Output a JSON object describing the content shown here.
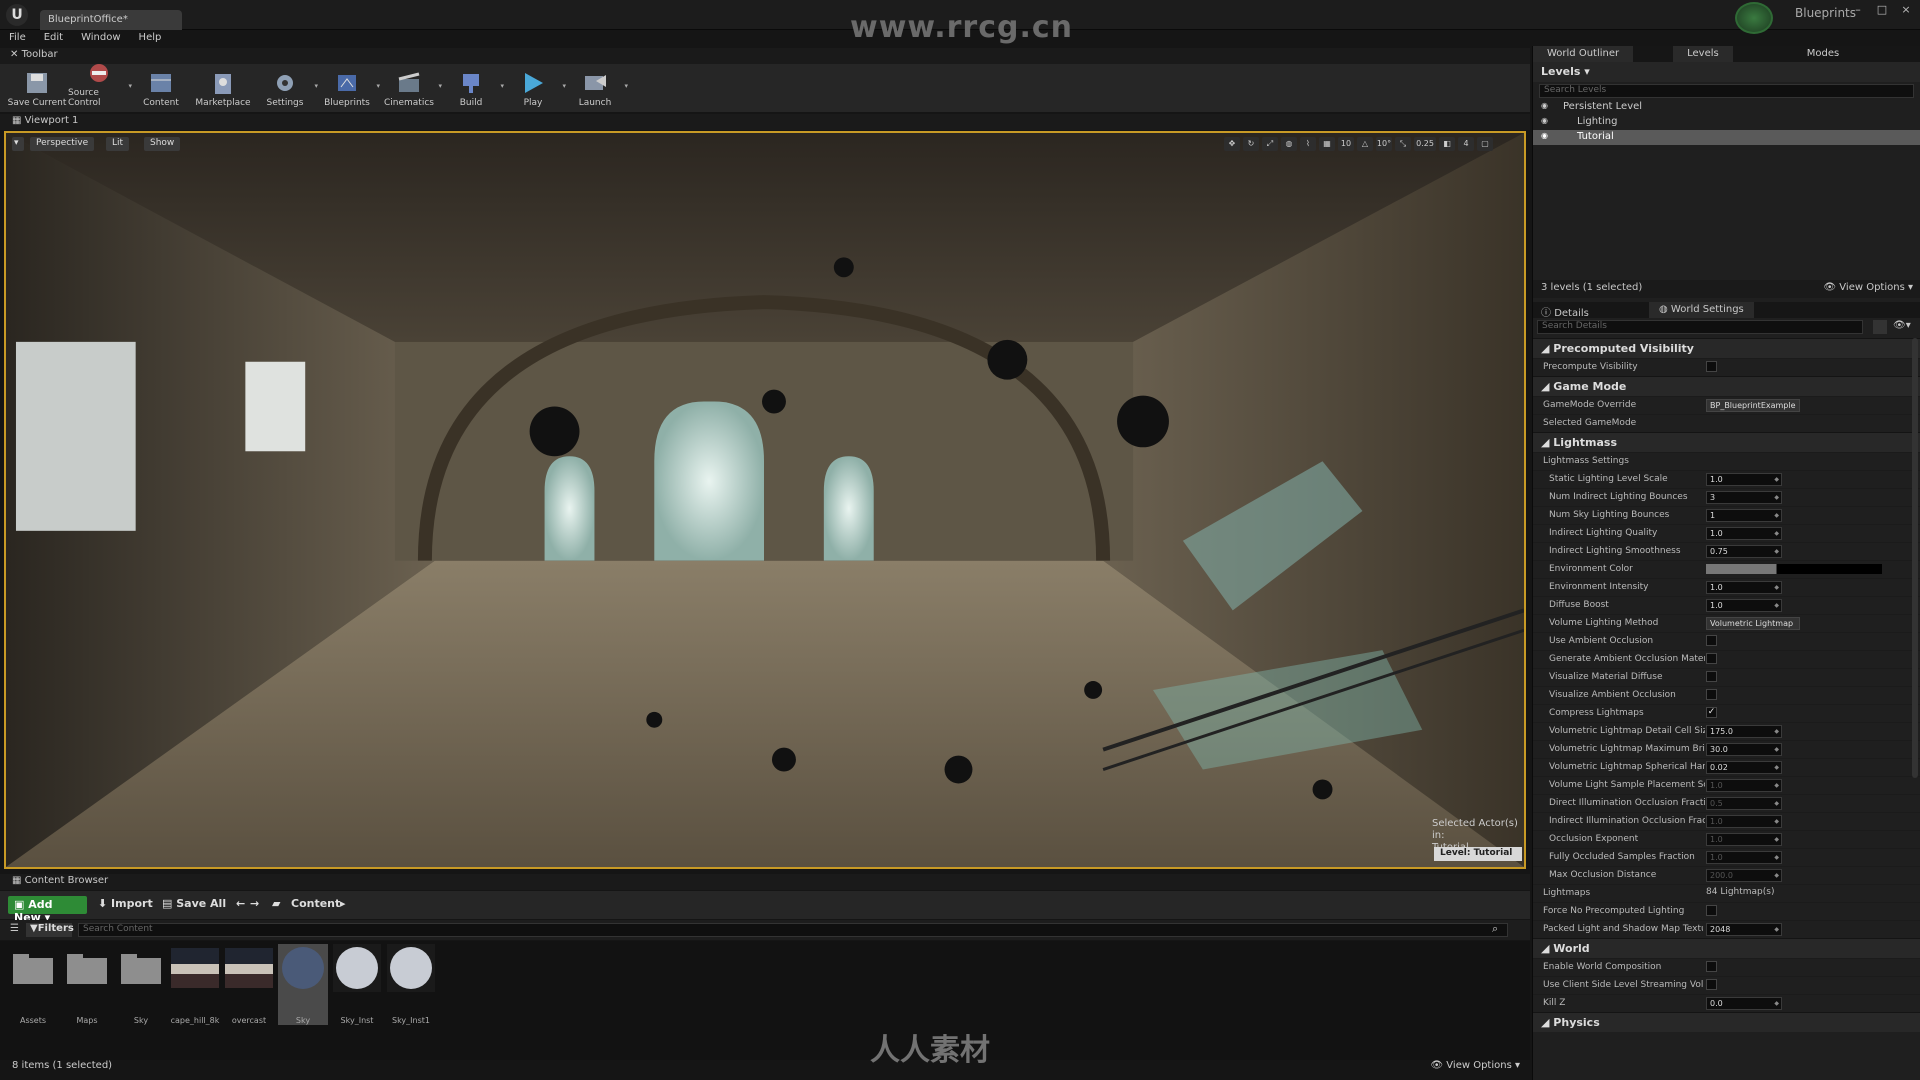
{
  "title_bar": {
    "doc_tab": "BlueprintOffice*",
    "watermark": "www.rrcg.cn",
    "blueprints_label": "Blueprints",
    "window_buttons": [
      "–",
      "□",
      "×"
    ]
  },
  "menu": [
    "File",
    "Edit",
    "Window",
    "Help"
  ],
  "toolbar": {
    "tab": "Toolbar",
    "buttons": [
      {
        "label": "Save Current",
        "icon": "save-icon",
        "dd": false
      },
      {
        "label": "Source Control",
        "icon": "source-control-icon",
        "dd": true
      },
      {
        "label": "Content",
        "icon": "content-icon",
        "dd": false
      },
      {
        "label": "Marketplace",
        "icon": "marketplace-icon",
        "dd": false
      },
      {
        "label": "Settings",
        "icon": "settings-icon",
        "dd": true
      },
      {
        "label": "Blueprints",
        "icon": "blueprints-icon",
        "dd": true
      },
      {
        "label": "Cinematics",
        "icon": "cinematics-icon",
        "dd": true
      },
      {
        "label": "Build",
        "icon": "build-icon",
        "dd": true
      },
      {
        "label": "Play",
        "icon": "play-icon",
        "dd": true
      },
      {
        "label": "Launch",
        "icon": "launch-icon",
        "dd": true
      }
    ]
  },
  "viewport": {
    "tab": "Viewport 1",
    "perspective": "Perspective",
    "lit": "Lit",
    "show": "Show",
    "snap_values": [
      "10",
      "10°",
      "0.25",
      "4"
    ],
    "selected_actor_line1": "Selected Actor(s) in:",
    "selected_actor_line2": "Tutorial",
    "level_label": "Level:  Tutorial",
    "border_color": "#c89a25"
  },
  "content_browser": {
    "tab": "Content Browser",
    "add_new": "Add New",
    "import": "Import",
    "save_all": "Save All",
    "path": "Content",
    "filters": "Filters",
    "search_placeholder": "Search Content",
    "assets": [
      {
        "name": "Assets",
        "type": "folder"
      },
      {
        "name": "Maps",
        "type": "folder"
      },
      {
        "name": "Sky",
        "type": "folder"
      },
      {
        "name": "cape_hill_8k",
        "type": "texture"
      },
      {
        "name": "overcast",
        "type": "texture"
      },
      {
        "name": "Sky",
        "type": "material",
        "selected": true
      },
      {
        "name": "Sky_Inst",
        "type": "material"
      },
      {
        "name": "Sky_Inst1",
        "type": "material"
      }
    ],
    "status": "8 items (1 selected)",
    "view_options": "View Options"
  },
  "world_outliner": {
    "tabs": [
      "World Outliner",
      "Levels",
      "Modes"
    ],
    "levels_header": "Levels",
    "search_placeholder": "Search Levels",
    "rows": [
      {
        "name": "Persistent Level",
        "selected": false
      },
      {
        "name": "Lighting",
        "selected": false
      },
      {
        "name": "Tutorial",
        "selected": true
      }
    ],
    "footer": "3 levels (1 selected)",
    "view_options": "View Options"
  },
  "details": {
    "tabs": [
      "Details",
      "World Settings"
    ],
    "search_placeholder": "Search Details",
    "sections": [
      {
        "title": "Precomputed Visibility",
        "rows": [
          {
            "label": "Precompute Visibility",
            "kind": "check",
            "value": ""
          }
        ]
      },
      {
        "title": "Game Mode",
        "rows": [
          {
            "label": "GameMode Override",
            "kind": "dropdown",
            "value": "BP_BlueprintExample"
          },
          {
            "label": "Selected GameMode",
            "kind": "none",
            "value": ""
          }
        ]
      },
      {
        "title": "Lightmass",
        "rows": [
          {
            "label": "Lightmass Settings",
            "kind": "none",
            "value": ""
          },
          {
            "label": "Static Lighting Level Scale",
            "kind": "num",
            "value": "1.0"
          },
          {
            "label": "Num Indirect Lighting Bounces",
            "kind": "num",
            "value": "3"
          },
          {
            "label": "Num Sky Lighting Bounces",
            "kind": "num",
            "value": "1"
          },
          {
            "label": "Indirect Lighting Quality",
            "kind": "num",
            "value": "1.0"
          },
          {
            "label": "Indirect Lighting Smoothness",
            "kind": "num",
            "value": "0.75"
          },
          {
            "label": "Environment Color",
            "kind": "color",
            "value": ""
          },
          {
            "label": "Environment Intensity",
            "kind": "num",
            "value": "1.0"
          },
          {
            "label": "Diffuse Boost",
            "kind": "num",
            "value": "1.0"
          },
          {
            "label": "Volume Lighting Method",
            "kind": "dropdown",
            "value": "Volumetric Lightmap"
          },
          {
            "label": "Use Ambient Occlusion",
            "kind": "check",
            "value": ""
          },
          {
            "label": "Generate Ambient Occlusion Material M",
            "kind": "check",
            "value": ""
          },
          {
            "label": "Visualize Material Diffuse",
            "kind": "check",
            "value": ""
          },
          {
            "label": "Visualize Ambient Occlusion",
            "kind": "check",
            "value": ""
          },
          {
            "label": "Compress Lightmaps",
            "kind": "check",
            "value": "✓"
          },
          {
            "label": "Volumetric Lightmap Detail Cell Size",
            "kind": "num",
            "value": "175.0"
          },
          {
            "label": "Volumetric Lightmap Maximum Brick M",
            "kind": "num",
            "value": "30.0"
          },
          {
            "label": "Volumetric Lightmap Spherical Harmon",
            "kind": "num",
            "value": "0.02"
          },
          {
            "label": "Volume Light Sample Placement Scale",
            "kind": "numdim",
            "value": "1.0"
          },
          {
            "label": "Direct Illumination Occlusion Fraction",
            "kind": "numdim",
            "value": "0.5"
          },
          {
            "label": "Indirect Illumination Occlusion Fraction",
            "kind": "numdim",
            "value": "1.0"
          },
          {
            "label": "Occlusion Exponent",
            "kind": "numdim",
            "value": "1.0"
          },
          {
            "label": "Fully Occluded Samples Fraction",
            "kind": "numdim",
            "value": "1.0"
          },
          {
            "label": "Max Occlusion Distance",
            "kind": "numdim",
            "value": "200.0"
          },
          {
            "label": "Lightmaps",
            "kind": "text",
            "value": "84 Lightmap(s)"
          },
          {
            "label": "Force No Precomputed Lighting",
            "kind": "check",
            "value": ""
          },
          {
            "label": "Packed Light and Shadow Map Texture Siz",
            "kind": "num",
            "value": "2048"
          }
        ]
      },
      {
        "title": "World",
        "rows": [
          {
            "label": "Enable World Composition",
            "kind": "check",
            "value": ""
          },
          {
            "label": "Use Client Side Level Streaming Volumes",
            "kind": "check",
            "value": ""
          },
          {
            "label": "Kill Z",
            "kind": "num",
            "value": "0.0"
          }
        ]
      },
      {
        "title": "Physics",
        "rows": []
      }
    ]
  },
  "bottom_watermark": "人人素材"
}
